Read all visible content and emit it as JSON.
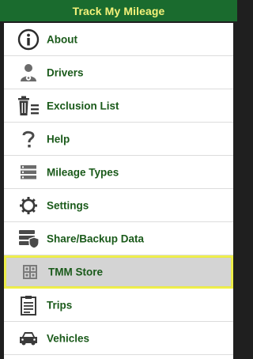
{
  "header": {
    "title": "Track My Mileage"
  },
  "menu": {
    "items": [
      {
        "label": "About",
        "icon": "info-icon"
      },
      {
        "label": "Drivers",
        "icon": "driver-icon"
      },
      {
        "label": "Exclusion List",
        "icon": "trash-list-icon"
      },
      {
        "label": "Help",
        "icon": "question-icon"
      },
      {
        "label": "Mileage Types",
        "icon": "list-icon"
      },
      {
        "label": "Settings",
        "icon": "gear-icon"
      },
      {
        "label": "Share/Backup Data",
        "icon": "database-shield-icon"
      },
      {
        "label": "TMM Store",
        "icon": "grid-icon",
        "selected": true
      },
      {
        "label": "Trips",
        "icon": "clipboard-icon"
      },
      {
        "label": "Vehicles",
        "icon": "car-icon"
      }
    ]
  },
  "colors": {
    "header_bg": "#1a6b2e",
    "header_text": "#f4f27a",
    "label_text": "#1a5a1a",
    "selected_bg": "#d4d4d4",
    "selected_border": "#f0f04a"
  }
}
